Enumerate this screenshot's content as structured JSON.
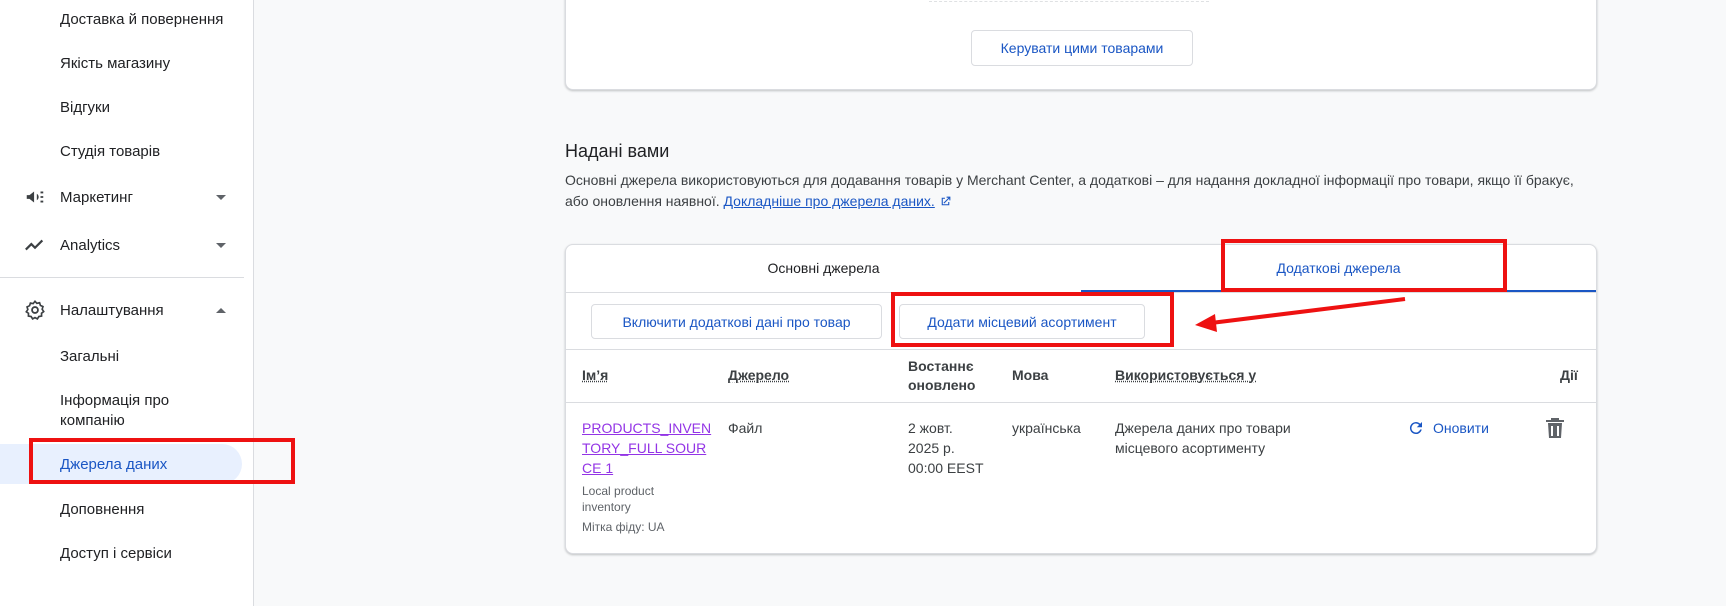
{
  "sidebar": {
    "items": [
      {
        "label": "Доставка й повернення"
      },
      {
        "label": "Якість магазину"
      },
      {
        "label": "Відгуки"
      },
      {
        "label": "Студія товарів"
      },
      {
        "label": "Маркетинг"
      },
      {
        "label": "Analytics"
      },
      {
        "label": "Налаштування"
      },
      {
        "label": "Загальні"
      },
      {
        "label": "Інформація про компанію"
      },
      {
        "label": "Джерела даних"
      },
      {
        "label": "Доповнення"
      },
      {
        "label": "Доступ і сервіси"
      }
    ]
  },
  "top_card": {
    "manage_button": "Керувати цими товарами"
  },
  "section": {
    "title": "Надані вами",
    "description": "Основні джерела використовуються для додавання товарів у Merchant Center, а додаткові – для надання докладної інформації про товари, якщо її бракує, або оновлення наявної.",
    "link": "Докладніше про джерела даних."
  },
  "tabs": [
    {
      "label": "Основні джерела"
    },
    {
      "label": "Додаткові джерела"
    }
  ],
  "actions": {
    "include_extra": "Включити додаткові дані про товар",
    "add_local": "Додати місцевий асортимент"
  },
  "table": {
    "headers": {
      "name": "Ім’я",
      "source": "Джерело",
      "updated": "Востаннє оновлено",
      "language": "Мова",
      "used_in": "Використовується у",
      "actions": "Дії"
    },
    "row": {
      "name": "PRODUCTS_INVENTORY_FULL SOURCE 1",
      "type": "Local product inventory",
      "feed_label": "Мітка фіду: UA",
      "source": "Файл",
      "updated_date": "2 жовт. 2025 р.",
      "updated_time": "00:00 EEST",
      "language": "українська",
      "used_in": "Джерела даних про товари місцевого асортименту",
      "refresh": "Оновити"
    }
  },
  "colors": {
    "accent": "#1a56c4",
    "highlight": "#ee1111",
    "link_visited": "#9334e6"
  }
}
